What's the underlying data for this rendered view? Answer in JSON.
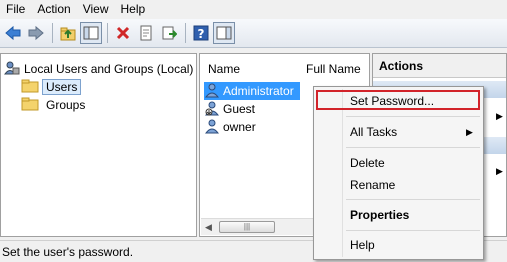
{
  "menu": [
    "File",
    "Action",
    "View",
    "Help"
  ],
  "toolbar": [
    "back-arrow-icon",
    "forward-arrow-icon",
    "up-folder-icon",
    "show-hide-tree-icon",
    "delete-icon",
    "properties-icon",
    "export-list-icon",
    "help-icon",
    "action-pane-icon"
  ],
  "tree": {
    "root": "Local Users and Groups (Local)",
    "items": [
      "Users",
      "Groups"
    ]
  },
  "list": {
    "col_name": "Name",
    "col_fullname": "Full Name",
    "rows": [
      "Administrator",
      "Guest",
      "owner"
    ]
  },
  "actions": {
    "title": "Actions"
  },
  "context_menu": {
    "set_password": "Set Password...",
    "all_tasks": "All Tasks",
    "delete": "Delete",
    "rename": "Rename",
    "properties": "Properties",
    "help": "Help"
  },
  "status": "Set the user's password.",
  "colors": {
    "highlight_border": "#d2232a",
    "selection": "#3399ff"
  }
}
